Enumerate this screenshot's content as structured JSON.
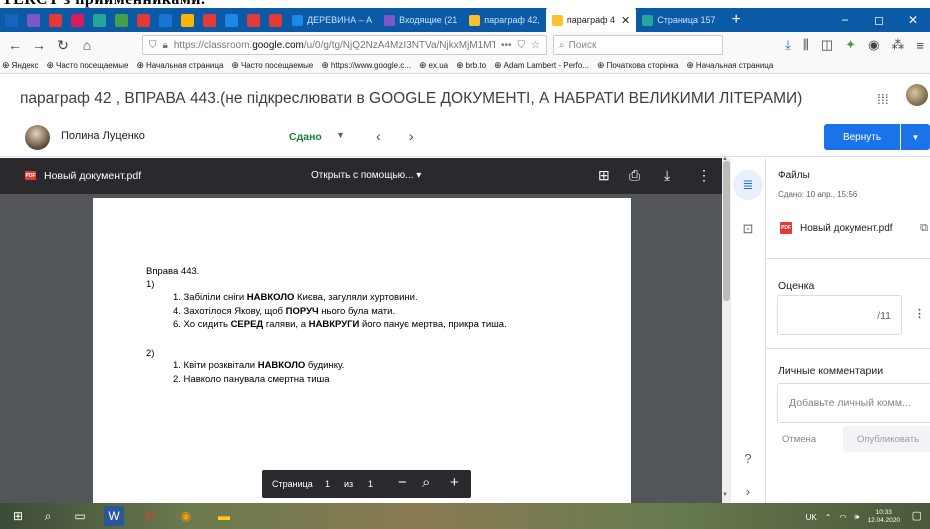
{
  "top_strip_text": "ТЕКСТ з прийменниками.",
  "colors": {
    "tabbar": "#0b5aa8",
    "accent": "#1a73e8",
    "submitted": "#188038",
    "pdf_red": "#e53935"
  },
  "browser": {
    "tab_icons": [
      "#1565c0",
      "#7e57c2",
      "#e53935",
      "#d81b60",
      "#26a69a",
      "#43a047",
      "#e53935",
      "#1976d2",
      "#ffb300",
      "#e53935",
      "#1e88e5",
      "#e53935",
      "#e53935"
    ],
    "tabs": [
      {
        "label": "ДЕРЕВИНА – А",
        "fav": "#1e88e5",
        "active": false
      },
      {
        "label": "Входящие (21",
        "fav": "#7e57c2",
        "active": false
      },
      {
        "label": "параграф 42,",
        "fav": "#fbc02d",
        "active": false
      },
      {
        "label": "параграф 4",
        "fav": "#fbc02d",
        "active": true
      },
      {
        "label": "Страница 157",
        "fav": "#26a69a",
        "active": false
      }
    ],
    "new_tab": "+",
    "window_controls": [
      "−",
      "◻",
      "✕"
    ],
    "nav": {
      "back": "←",
      "forward": "→",
      "reload": "↻",
      "home": "⌂"
    },
    "url_prefix": "https://classroom.",
    "url_domain": "google.com",
    "url_rest": "/u/0/g/tg/NjQ2NzA4MzI3NTVa/NjkxMjM1MTA",
    "url_more": "•••",
    "search_placeholder": "Поиск",
    "bookmarks": [
      "Яндекс",
      "Часто посещаемые",
      "Начальная страница",
      "Часто посещаемые",
      "https://www.google.c...",
      "ex.ua",
      "brb.to",
      "Adam Lambert - Perfo...",
      "Початкова сторінка",
      "Начальная страница"
    ]
  },
  "header": {
    "title": "параграф 42 , ВПРАВА 443.(не підкреслювати в GOOGLE ДОКУМЕНТІ, А НАБРАТИ ВЕЛИКИМИ ЛІТЕРАМИ)"
  },
  "student_bar": {
    "name": "Полина Луценко",
    "status": "Сдано",
    "return_label": "Вернуть"
  },
  "viewer": {
    "filename": "Новый документ.pdf",
    "open_with": "Открыть с помощью... ▾",
    "page_label": "Страница",
    "page_current": "1",
    "page_of": "из",
    "page_total": "1",
    "pdf_badge": "PDF"
  },
  "document": {
    "heading": "Вправа 443.",
    "section1": "1)",
    "lines1": [
      [
        "1.  Забіліли сніги ",
        "НАВКОЛО",
        " Києва, загуляли хуртовини."
      ],
      [
        "4.  Захотілося Якову, щоб ",
        "ПОРУЧ",
        " нього була мати."
      ],
      [
        "6. Хо сидить ",
        "СЕРЕД",
        " галяви, а ",
        "НАВКРУГИ",
        " його панує мертва, прикра тиша."
      ]
    ],
    "section2": "2)",
    "lines2": [
      [
        "1.  Квіти розквітали ",
        "НАВКОЛО",
        " будинку."
      ],
      [
        "2.  Навколо панувала смертна тиша"
      ]
    ]
  },
  "panel": {
    "files_title": "Файлы",
    "submitted_at": "Сдано: 10 апр., 15:56",
    "file_name": "Новый документ.pdf",
    "grade_title": "Оценка",
    "grade_max": "/11",
    "comments_title": "Личные комментарии",
    "comment_placeholder": "Добавьте личный комм...",
    "cancel_label": "Отмена",
    "publish_label": "Опубликовать"
  },
  "taskbar": {
    "lang": "UK",
    "time": "10:33",
    "date": "12.04.2020"
  }
}
